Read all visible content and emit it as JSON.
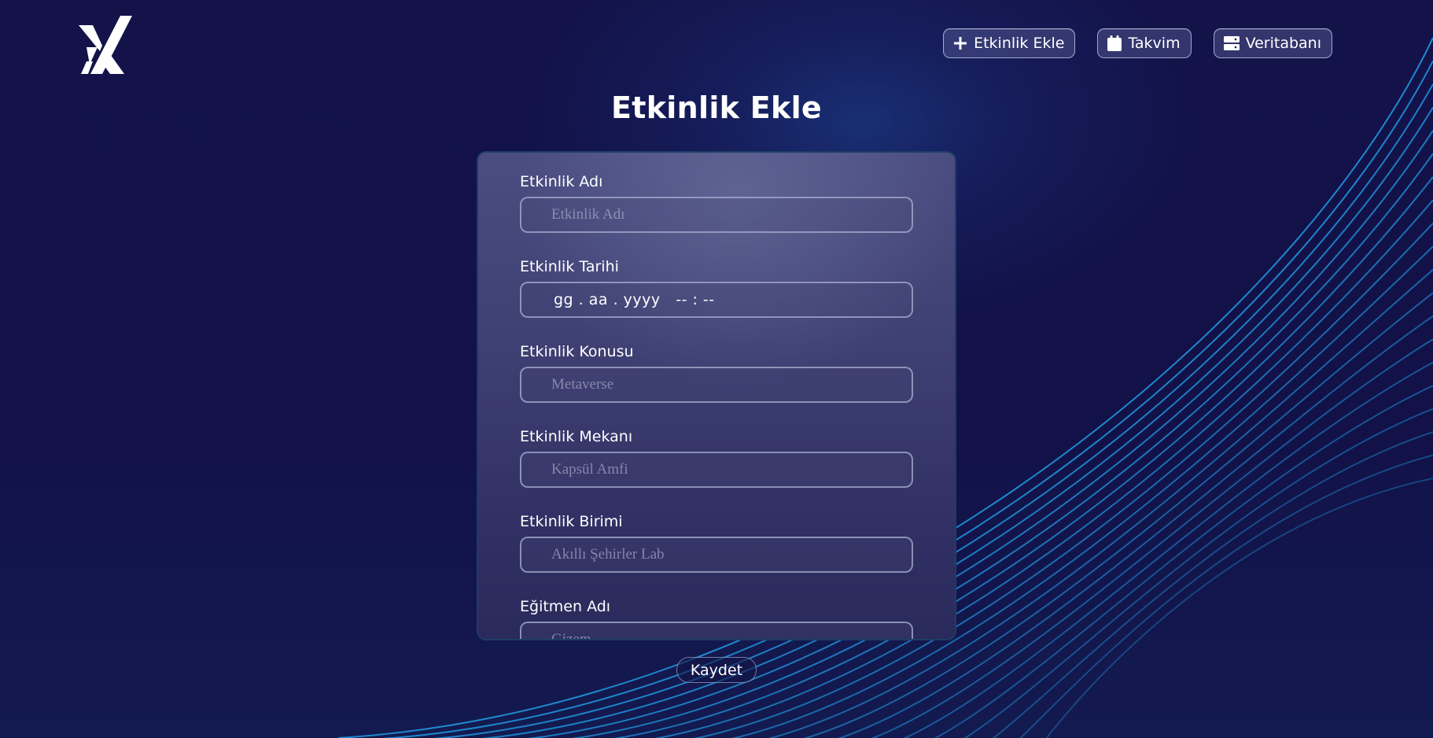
{
  "logo": {
    "icon": "yk-logo-icon"
  },
  "nav": {
    "items": [
      {
        "label": "Etkinlik Ekle",
        "icon": "plus-icon"
      },
      {
        "label": "Takvim",
        "icon": "calendar-icon"
      },
      {
        "label": "Veritabanı",
        "icon": "server-icon"
      }
    ]
  },
  "page": {
    "title": "Etkinlik Ekle"
  },
  "form": {
    "fields": [
      {
        "label": "Etkinlik Adı",
        "placeholder": "Etkinlik Adı",
        "value": ""
      },
      {
        "label": "Etkinlik Tarihi",
        "display": "gg . aa . yyyy   -- : --"
      },
      {
        "label": "Etkinlik Konusu",
        "placeholder": "Metaverse",
        "value": ""
      },
      {
        "label": "Etkinlik Mekanı",
        "placeholder": "Kapsül Amfi",
        "value": ""
      },
      {
        "label": "Etkinlik Birimi",
        "placeholder": "Akıllı Şehirler Lab",
        "value": ""
      },
      {
        "label": "Eğitmen Adı",
        "placeholder": "Gizem",
        "value": ""
      }
    ],
    "save_label": "Kaydet"
  },
  "colors": {
    "background": "#13134a",
    "accent_lines": "#1f8fd6",
    "card_border": "#1d3d66"
  }
}
